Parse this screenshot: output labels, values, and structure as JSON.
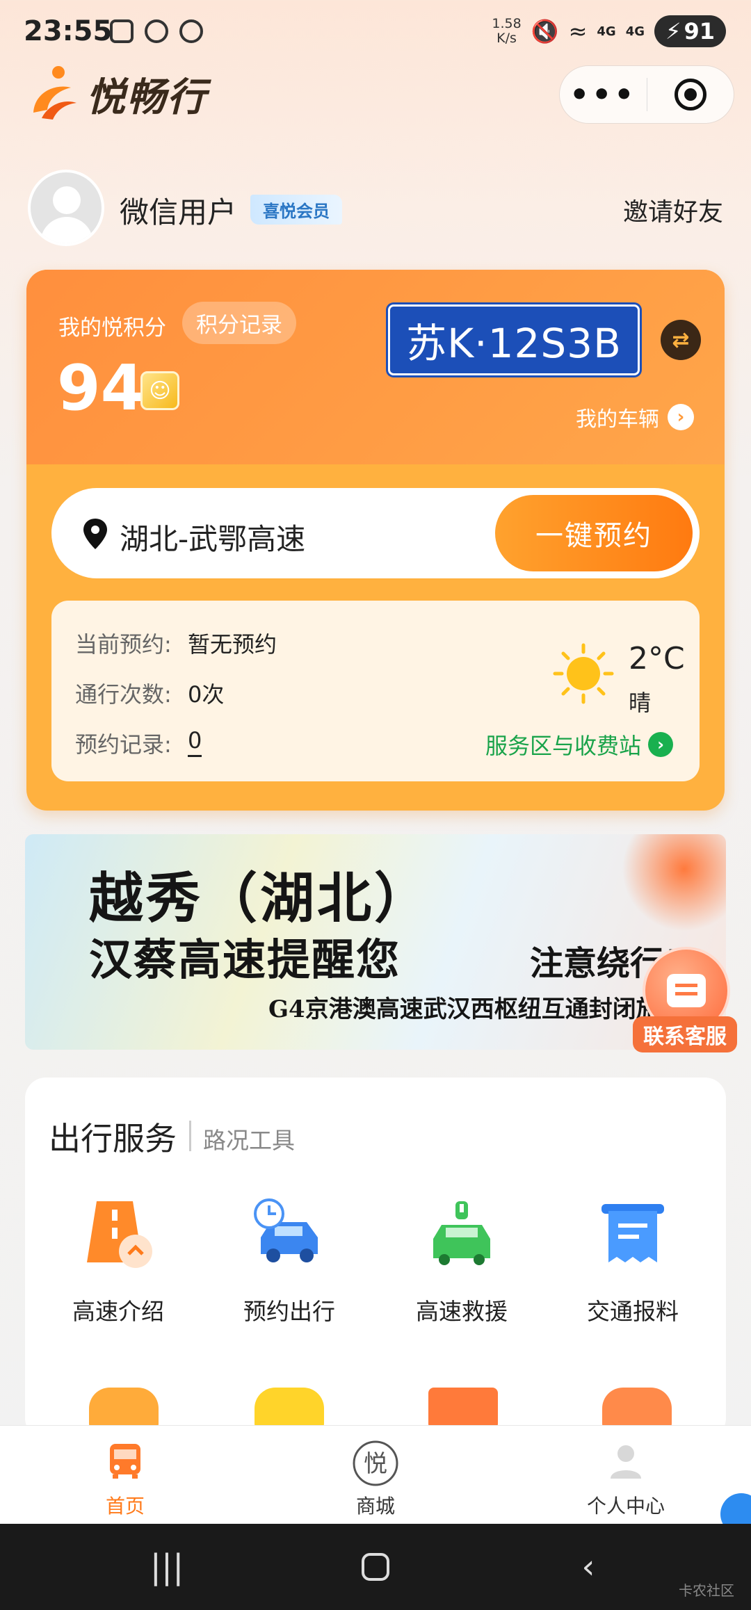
{
  "status_bar": {
    "time": "23:55",
    "net_speed_value": "1.58",
    "net_speed_unit": "K/s",
    "battery": "91",
    "signal1": "4G",
    "signal2": "4G"
  },
  "header": {
    "app_name": "悦畅行"
  },
  "user": {
    "name": "微信用户",
    "badge": "喜悦会员",
    "invite": "邀请好友"
  },
  "card": {
    "points_label": "我的悦积分",
    "points_record": "积分记录",
    "points_value": "94",
    "plate": "苏K·12S3B",
    "my_vehicle": "我的车辆",
    "route": "湖北-武鄂高速",
    "reserve_button": "一键预约",
    "info": {
      "current_label": "当前预约:",
      "current_value": "暂无预约",
      "count_label": "通行次数:",
      "count_value": "0次",
      "records_label": "预约记录:",
      "records_value": "0"
    },
    "weather": {
      "temp": "2°C",
      "desc": "晴"
    },
    "service_link": "服务区与收费站"
  },
  "banner": {
    "line1": "越秀（湖北）",
    "line2": "汉蔡高速提醒您",
    "line3": "注意绕行！",
    "line4": "G4京港澳高速武汉西枢纽互通封闭施"
  },
  "support": {
    "label": "联系客服"
  },
  "services": {
    "title": "出行服务",
    "subtitle": "路况工具",
    "items": [
      {
        "label": "高速介绍"
      },
      {
        "label": "预约出行"
      },
      {
        "label": "高速救援"
      },
      {
        "label": "交通报料"
      }
    ]
  },
  "bottom_nav": {
    "items": [
      {
        "label": "首页"
      },
      {
        "label": "商城"
      },
      {
        "label": "个人中心"
      }
    ]
  },
  "watermark": "卡农社区",
  "colors": {
    "accent": "#ff8f3d",
    "green": "#19a34a",
    "plate_blue": "#1c4fb8"
  }
}
